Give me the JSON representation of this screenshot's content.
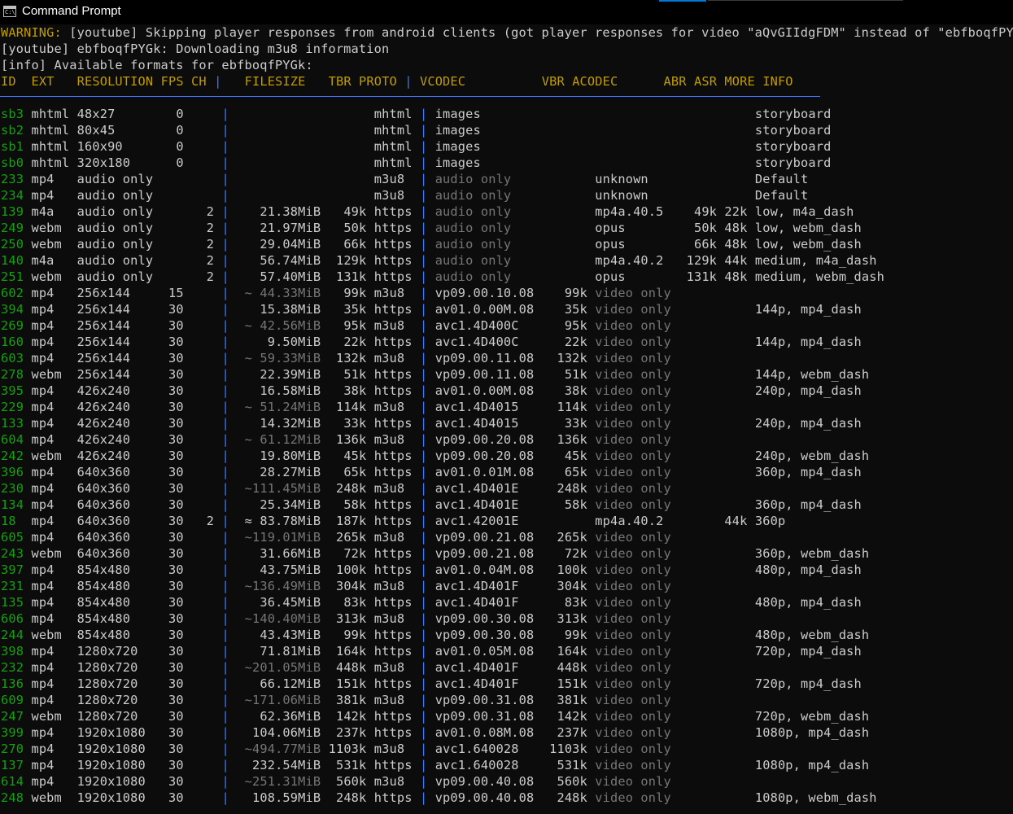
{
  "window": {
    "title": "Command Prompt",
    "icon": "command-prompt-icon"
  },
  "messages": [
    {
      "prefix": "WARNING:",
      "text": " [youtube] Skipping player responses from android clients (got player responses for video \"aQvGIIdgFDM\" instead of \"ebfboqfPYGk\")"
    },
    {
      "prefix": "",
      "text": "[youtube] ebfboqfPYGk: Downloading m3u8 information"
    },
    {
      "prefix": "",
      "text": "[info] Available formats for ebfboqfPYGk:"
    }
  ],
  "headers": {
    "id": "ID",
    "ext": "EXT",
    "resolution": "RESOLUTION",
    "fps": "FPS",
    "ch": "CH",
    "filesize": "FILESIZE",
    "tbr": "TBR",
    "proto": "PROTO",
    "vcodec": "VCODEC",
    "vbr": "VBR",
    "acodec": "ACODEC",
    "abr": "ABR",
    "asr": "ASR",
    "more_info": "MORE INFO"
  },
  "formats": [
    {
      "id": "sb3",
      "ext": "mhtml",
      "resolution": "48x27",
      "fps": "0",
      "ch": "",
      "filesize": "",
      "tbr": "",
      "proto": "mhtml",
      "vcodec": "images",
      "vbr": "",
      "acodec": "",
      "abr": "",
      "asr": "",
      "more": "storyboard"
    },
    {
      "id": "sb2",
      "ext": "mhtml",
      "resolution": "80x45",
      "fps": "0",
      "ch": "",
      "filesize": "",
      "tbr": "",
      "proto": "mhtml",
      "vcodec": "images",
      "vbr": "",
      "acodec": "",
      "abr": "",
      "asr": "",
      "more": "storyboard"
    },
    {
      "id": "sb1",
      "ext": "mhtml",
      "resolution": "160x90",
      "fps": "0",
      "ch": "",
      "filesize": "",
      "tbr": "",
      "proto": "mhtml",
      "vcodec": "images",
      "vbr": "",
      "acodec": "",
      "abr": "",
      "asr": "",
      "more": "storyboard"
    },
    {
      "id": "sb0",
      "ext": "mhtml",
      "resolution": "320x180",
      "fps": "0",
      "ch": "",
      "filesize": "",
      "tbr": "",
      "proto": "mhtml",
      "vcodec": "images",
      "vbr": "",
      "acodec": "",
      "abr": "",
      "asr": "",
      "more": "storyboard"
    },
    {
      "id": "233",
      "ext": "mp4",
      "resolution": "audio only",
      "fps": "",
      "ch": "",
      "filesize": "",
      "tbr": "",
      "proto": "m3u8",
      "vcodec": "audio only",
      "vbr": "",
      "acodec": "unknown",
      "abr": "",
      "asr": "",
      "more": "Default"
    },
    {
      "id": "234",
      "ext": "mp4",
      "resolution": "audio only",
      "fps": "",
      "ch": "",
      "filesize": "",
      "tbr": "",
      "proto": "m3u8",
      "vcodec": "audio only",
      "vbr": "",
      "acodec": "unknown",
      "abr": "",
      "asr": "",
      "more": "Default"
    },
    {
      "id": "139",
      "ext": "m4a",
      "resolution": "audio only",
      "fps": "",
      "ch": "2",
      "filesize": "21.38MiB",
      "tbr": "49k",
      "proto": "https",
      "vcodec": "audio only",
      "vbr": "",
      "acodec": "mp4a.40.5",
      "abr": "49k",
      "asr": "22k",
      "more": "low, m4a_dash"
    },
    {
      "id": "249",
      "ext": "webm",
      "resolution": "audio only",
      "fps": "",
      "ch": "2",
      "filesize": "21.97MiB",
      "tbr": "50k",
      "proto": "https",
      "vcodec": "audio only",
      "vbr": "",
      "acodec": "opus",
      "abr": "50k",
      "asr": "48k",
      "more": "low, webm_dash"
    },
    {
      "id": "250",
      "ext": "webm",
      "resolution": "audio only",
      "fps": "",
      "ch": "2",
      "filesize": "29.04MiB",
      "tbr": "66k",
      "proto": "https",
      "vcodec": "audio only",
      "vbr": "",
      "acodec": "opus",
      "abr": "66k",
      "asr": "48k",
      "more": "low, webm_dash"
    },
    {
      "id": "140",
      "ext": "m4a",
      "resolution": "audio only",
      "fps": "",
      "ch": "2",
      "filesize": "56.74MiB",
      "tbr": "129k",
      "proto": "https",
      "vcodec": "audio only",
      "vbr": "",
      "acodec": "mp4a.40.2",
      "abr": "129k",
      "asr": "44k",
      "more": "medium, m4a_dash"
    },
    {
      "id": "251",
      "ext": "webm",
      "resolution": "audio only",
      "fps": "",
      "ch": "2",
      "filesize": "57.40MiB",
      "tbr": "131k",
      "proto": "https",
      "vcodec": "audio only",
      "vbr": "",
      "acodec": "opus",
      "abr": "131k",
      "asr": "48k",
      "more": "medium, webm_dash"
    },
    {
      "id": "602",
      "ext": "mp4",
      "resolution": "256x144",
      "fps": "15",
      "ch": "",
      "filesize": "~ 44.33MiB",
      "tbr": "99k",
      "proto": "m3u8",
      "vcodec": "vp09.00.10.08",
      "vbr": "99k",
      "acodec": "video only",
      "abr": "",
      "asr": "",
      "more": ""
    },
    {
      "id": "394",
      "ext": "mp4",
      "resolution": "256x144",
      "fps": "30",
      "ch": "",
      "filesize": "15.38MiB",
      "tbr": "35k",
      "proto": "https",
      "vcodec": "av01.0.00M.08",
      "vbr": "35k",
      "acodec": "video only",
      "abr": "",
      "asr": "",
      "more": "144p, mp4_dash"
    },
    {
      "id": "269",
      "ext": "mp4",
      "resolution": "256x144",
      "fps": "30",
      "ch": "",
      "filesize": "~ 42.56MiB",
      "tbr": "95k",
      "proto": "m3u8",
      "vcodec": "avc1.4D400C",
      "vbr": "95k",
      "acodec": "video only",
      "abr": "",
      "asr": "",
      "more": ""
    },
    {
      "id": "160",
      "ext": "mp4",
      "resolution": "256x144",
      "fps": "30",
      "ch": "",
      "filesize": "9.50MiB",
      "tbr": "22k",
      "proto": "https",
      "vcodec": "avc1.4D400C",
      "vbr": "22k",
      "acodec": "video only",
      "abr": "",
      "asr": "",
      "more": "144p, mp4_dash"
    },
    {
      "id": "603",
      "ext": "mp4",
      "resolution": "256x144",
      "fps": "30",
      "ch": "",
      "filesize": "~ 59.33MiB",
      "tbr": "132k",
      "proto": "m3u8",
      "vcodec": "vp09.00.11.08",
      "vbr": "132k",
      "acodec": "video only",
      "abr": "",
      "asr": "",
      "more": ""
    },
    {
      "id": "278",
      "ext": "webm",
      "resolution": "256x144",
      "fps": "30",
      "ch": "",
      "filesize": "22.39MiB",
      "tbr": "51k",
      "proto": "https",
      "vcodec": "vp09.00.11.08",
      "vbr": "51k",
      "acodec": "video only",
      "abr": "",
      "asr": "",
      "more": "144p, webm_dash"
    },
    {
      "id": "395",
      "ext": "mp4",
      "resolution": "426x240",
      "fps": "30",
      "ch": "",
      "filesize": "16.58MiB",
      "tbr": "38k",
      "proto": "https",
      "vcodec": "av01.0.00M.08",
      "vbr": "38k",
      "acodec": "video only",
      "abr": "",
      "asr": "",
      "more": "240p, mp4_dash"
    },
    {
      "id": "229",
      "ext": "mp4",
      "resolution": "426x240",
      "fps": "30",
      "ch": "",
      "filesize": "~ 51.24MiB",
      "tbr": "114k",
      "proto": "m3u8",
      "vcodec": "avc1.4D4015",
      "vbr": "114k",
      "acodec": "video only",
      "abr": "",
      "asr": "",
      "more": ""
    },
    {
      "id": "133",
      "ext": "mp4",
      "resolution": "426x240",
      "fps": "30",
      "ch": "",
      "filesize": "14.32MiB",
      "tbr": "33k",
      "proto": "https",
      "vcodec": "avc1.4D4015",
      "vbr": "33k",
      "acodec": "video only",
      "abr": "",
      "asr": "",
      "more": "240p, mp4_dash"
    },
    {
      "id": "604",
      "ext": "mp4",
      "resolution": "426x240",
      "fps": "30",
      "ch": "",
      "filesize": "~ 61.12MiB",
      "tbr": "136k",
      "proto": "m3u8",
      "vcodec": "vp09.00.20.08",
      "vbr": "136k",
      "acodec": "video only",
      "abr": "",
      "asr": "",
      "more": ""
    },
    {
      "id": "242",
      "ext": "webm",
      "resolution": "426x240",
      "fps": "30",
      "ch": "",
      "filesize": "19.80MiB",
      "tbr": "45k",
      "proto": "https",
      "vcodec": "vp09.00.20.08",
      "vbr": "45k",
      "acodec": "video only",
      "abr": "",
      "asr": "",
      "more": "240p, webm_dash"
    },
    {
      "id": "396",
      "ext": "mp4",
      "resolution": "640x360",
      "fps": "30",
      "ch": "",
      "filesize": "28.27MiB",
      "tbr": "65k",
      "proto": "https",
      "vcodec": "av01.0.01M.08",
      "vbr": "65k",
      "acodec": "video only",
      "abr": "",
      "asr": "",
      "more": "360p, mp4_dash"
    },
    {
      "id": "230",
      "ext": "mp4",
      "resolution": "640x360",
      "fps": "30",
      "ch": "",
      "filesize": "~111.45MiB",
      "tbr": "248k",
      "proto": "m3u8",
      "vcodec": "avc1.4D401E",
      "vbr": "248k",
      "acodec": "video only",
      "abr": "",
      "asr": "",
      "more": ""
    },
    {
      "id": "134",
      "ext": "mp4",
      "resolution": "640x360",
      "fps": "30",
      "ch": "",
      "filesize": "25.34MiB",
      "tbr": "58k",
      "proto": "https",
      "vcodec": "avc1.4D401E",
      "vbr": "58k",
      "acodec": "video only",
      "abr": "",
      "asr": "",
      "more": "360p, mp4_dash"
    },
    {
      "id": "18",
      "ext": "mp4",
      "resolution": "640x360",
      "fps": "30",
      "ch": "2",
      "filesize": "≈ 83.78MiB",
      "tbr": "187k",
      "proto": "https",
      "vcodec": "avc1.42001E",
      "vbr": "",
      "acodec": "mp4a.40.2",
      "abr": "",
      "asr": "44k",
      "more": "360p"
    },
    {
      "id": "605",
      "ext": "mp4",
      "resolution": "640x360",
      "fps": "30",
      "ch": "",
      "filesize": "~119.01MiB",
      "tbr": "265k",
      "proto": "m3u8",
      "vcodec": "vp09.00.21.08",
      "vbr": "265k",
      "acodec": "video only",
      "abr": "",
      "asr": "",
      "more": ""
    },
    {
      "id": "243",
      "ext": "webm",
      "resolution": "640x360",
      "fps": "30",
      "ch": "",
      "filesize": "31.66MiB",
      "tbr": "72k",
      "proto": "https",
      "vcodec": "vp09.00.21.08",
      "vbr": "72k",
      "acodec": "video only",
      "abr": "",
      "asr": "",
      "more": "360p, webm_dash"
    },
    {
      "id": "397",
      "ext": "mp4",
      "resolution": "854x480",
      "fps": "30",
      "ch": "",
      "filesize": "43.75MiB",
      "tbr": "100k",
      "proto": "https",
      "vcodec": "av01.0.04M.08",
      "vbr": "100k",
      "acodec": "video only",
      "abr": "",
      "asr": "",
      "more": "480p, mp4_dash"
    },
    {
      "id": "231",
      "ext": "mp4",
      "resolution": "854x480",
      "fps": "30",
      "ch": "",
      "filesize": "~136.49MiB",
      "tbr": "304k",
      "proto": "m3u8",
      "vcodec": "avc1.4D401F",
      "vbr": "304k",
      "acodec": "video only",
      "abr": "",
      "asr": "",
      "more": ""
    },
    {
      "id": "135",
      "ext": "mp4",
      "resolution": "854x480",
      "fps": "30",
      "ch": "",
      "filesize": "36.45MiB",
      "tbr": "83k",
      "proto": "https",
      "vcodec": "avc1.4D401F",
      "vbr": "83k",
      "acodec": "video only",
      "abr": "",
      "asr": "",
      "more": "480p, mp4_dash"
    },
    {
      "id": "606",
      "ext": "mp4",
      "resolution": "854x480",
      "fps": "30",
      "ch": "",
      "filesize": "~140.40MiB",
      "tbr": "313k",
      "proto": "m3u8",
      "vcodec": "vp09.00.30.08",
      "vbr": "313k",
      "acodec": "video only",
      "abr": "",
      "asr": "",
      "more": ""
    },
    {
      "id": "244",
      "ext": "webm",
      "resolution": "854x480",
      "fps": "30",
      "ch": "",
      "filesize": "43.43MiB",
      "tbr": "99k",
      "proto": "https",
      "vcodec": "vp09.00.30.08",
      "vbr": "99k",
      "acodec": "video only",
      "abr": "",
      "asr": "",
      "more": "480p, webm_dash"
    },
    {
      "id": "398",
      "ext": "mp4",
      "resolution": "1280x720",
      "fps": "30",
      "ch": "",
      "filesize": "71.81MiB",
      "tbr": "164k",
      "proto": "https",
      "vcodec": "av01.0.05M.08",
      "vbr": "164k",
      "acodec": "video only",
      "abr": "",
      "asr": "",
      "more": "720p, mp4_dash"
    },
    {
      "id": "232",
      "ext": "mp4",
      "resolution": "1280x720",
      "fps": "30",
      "ch": "",
      "filesize": "~201.05MiB",
      "tbr": "448k",
      "proto": "m3u8",
      "vcodec": "avc1.4D401F",
      "vbr": "448k",
      "acodec": "video only",
      "abr": "",
      "asr": "",
      "more": ""
    },
    {
      "id": "136",
      "ext": "mp4",
      "resolution": "1280x720",
      "fps": "30",
      "ch": "",
      "filesize": "66.12MiB",
      "tbr": "151k",
      "proto": "https",
      "vcodec": "avc1.4D401F",
      "vbr": "151k",
      "acodec": "video only",
      "abr": "",
      "asr": "",
      "more": "720p, mp4_dash"
    },
    {
      "id": "609",
      "ext": "mp4",
      "resolution": "1280x720",
      "fps": "30",
      "ch": "",
      "filesize": "~171.06MiB",
      "tbr": "381k",
      "proto": "m3u8",
      "vcodec": "vp09.00.31.08",
      "vbr": "381k",
      "acodec": "video only",
      "abr": "",
      "asr": "",
      "more": ""
    },
    {
      "id": "247",
      "ext": "webm",
      "resolution": "1280x720",
      "fps": "30",
      "ch": "",
      "filesize": "62.36MiB",
      "tbr": "142k",
      "proto": "https",
      "vcodec": "vp09.00.31.08",
      "vbr": "142k",
      "acodec": "video only",
      "abr": "",
      "asr": "",
      "more": "720p, webm_dash"
    },
    {
      "id": "399",
      "ext": "mp4",
      "resolution": "1920x1080",
      "fps": "30",
      "ch": "",
      "filesize": "104.06MiB",
      "tbr": "237k",
      "proto": "https",
      "vcodec": "av01.0.08M.08",
      "vbr": "237k",
      "acodec": "video only",
      "abr": "",
      "asr": "",
      "more": "1080p, mp4_dash"
    },
    {
      "id": "270",
      "ext": "mp4",
      "resolution": "1920x1080",
      "fps": "30",
      "ch": "",
      "filesize": "~494.77MiB",
      "tbr": "1103k",
      "proto": "m3u8",
      "vcodec": "avc1.640028",
      "vbr": "1103k",
      "acodec": "video only",
      "abr": "",
      "asr": "",
      "more": ""
    },
    {
      "id": "137",
      "ext": "mp4",
      "resolution": "1920x1080",
      "fps": "30",
      "ch": "",
      "filesize": "232.54MiB",
      "tbr": "531k",
      "proto": "https",
      "vcodec": "avc1.640028",
      "vbr": "531k",
      "acodec": "video only",
      "abr": "",
      "asr": "",
      "more": "1080p, mp4_dash"
    },
    {
      "id": "614",
      "ext": "mp4",
      "resolution": "1920x1080",
      "fps": "30",
      "ch": "",
      "filesize": "~251.31MiB",
      "tbr": "560k",
      "proto": "m3u8",
      "vcodec": "vp09.00.40.08",
      "vbr": "560k",
      "acodec": "video only",
      "abr": "",
      "asr": "",
      "more": ""
    },
    {
      "id": "248",
      "ext": "webm",
      "resolution": "1920x1080",
      "fps": "30",
      "ch": "",
      "filesize": "108.59MiB",
      "tbr": "248k",
      "proto": "https",
      "vcodec": "vp09.00.40.08",
      "vbr": "248k",
      "acodec": "video only",
      "abr": "",
      "asr": "",
      "more": "1080p, webm_dash"
    }
  ],
  "colors": {
    "background": "#0c0c0c",
    "text": "#cccccc",
    "warning": "#c19c00",
    "header": "#c19c00",
    "id": "#13a10e",
    "dim": "#767676",
    "separator": "#3b78ff",
    "titlebar": "#000000"
  }
}
